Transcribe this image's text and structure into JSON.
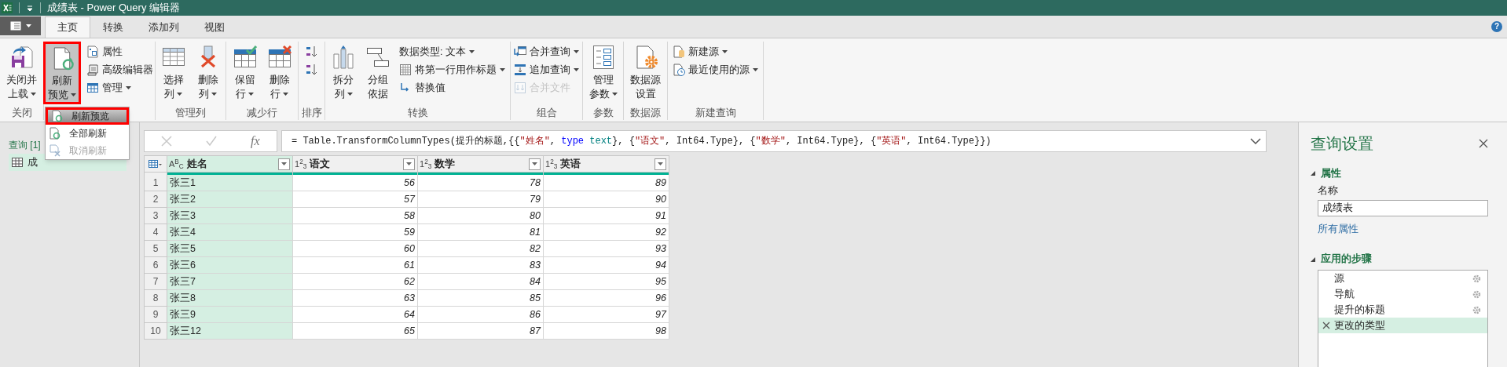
{
  "window": {
    "title": "成绩表 - Power Query 编辑器"
  },
  "help": "?",
  "tabs": [
    {
      "label": "主页",
      "selected": true
    },
    {
      "label": "转换",
      "selected": false
    },
    {
      "label": "添加列",
      "selected": false
    },
    {
      "label": "视图",
      "selected": false
    }
  ],
  "ribbon": [
    {
      "label": "关闭",
      "items": [
        {
          "kind": "large",
          "lines": [
            "关闭并",
            "上载"
          ],
          "dropdown": true,
          "pressed": false,
          "highlighted": false,
          "disabled": false
        }
      ]
    },
    {
      "items": [
        {
          "kind": "large",
          "lines": [
            "刷新",
            "预览"
          ],
          "dropdown": true,
          "pressed": true,
          "highlighted": true,
          "disabled": false
        },
        {
          "kind": "small",
          "label": "属性",
          "dropdown": false,
          "pressed": false,
          "highlighted": false,
          "disabled": false
        },
        {
          "kind": "small",
          "label": "高级编辑器",
          "dropdown": false,
          "pressed": false,
          "highlighted": false,
          "disabled": false
        },
        {
          "kind": "small",
          "label": "管理",
          "dropdown": true,
          "pressed": false,
          "highlighted": false,
          "disabled": false
        }
      ]
    },
    {
      "label": "管理列",
      "items": [
        {
          "kind": "large",
          "lines": [
            "选择",
            "列"
          ],
          "dropdown": true,
          "pressed": false,
          "highlighted": false,
          "disabled": false
        },
        {
          "kind": "large",
          "lines": [
            "删除",
            "列"
          ],
          "dropdown": true,
          "pressed": false,
          "highlighted": false,
          "disabled": false
        }
      ]
    },
    {
      "label": "减少行",
      "items": [
        {
          "kind": "large",
          "lines": [
            "保留",
            "行"
          ],
          "dropdown": true,
          "pressed": false,
          "highlighted": false,
          "disabled": false
        },
        {
          "kind": "large",
          "lines": [
            "删除",
            "行"
          ],
          "dropdown": true,
          "pressed": false,
          "highlighted": false,
          "disabled": false
        }
      ]
    },
    {
      "label": "排序",
      "items": [
        {
          "kind": "icon",
          "dropdown": false,
          "pressed": false,
          "highlighted": false,
          "disabled": false
        },
        {
          "kind": "icon",
          "dropdown": false,
          "pressed": false,
          "highlighted": false,
          "disabled": false
        }
      ]
    },
    {
      "label": "转换",
      "items": [
        {
          "kind": "large",
          "lines": [
            "拆分",
            "列"
          ],
          "dropdown": true,
          "pressed": false,
          "highlighted": false,
          "disabled": false
        },
        {
          "kind": "large",
          "lines": [
            "分组",
            "依据"
          ],
          "dropdown": false,
          "pressed": false,
          "highlighted": false,
          "disabled": false
        },
        {
          "kind": "small",
          "label": "数据类型: 文本",
          "dropdown": true,
          "pressed": false,
          "highlighted": false,
          "disabled": false
        },
        {
          "kind": "small",
          "label": "将第一行用作标题",
          "dropdown": true,
          "pressed": false,
          "highlighted": false,
          "disabled": false
        },
        {
          "kind": "small",
          "label": "替换值",
          "dropdown": false,
          "pressed": false,
          "highlighted": false,
          "disabled": false
        }
      ]
    },
    {
      "label": "组合",
      "items": [
        {
          "kind": "small",
          "label": "合并查询",
          "dropdown": true,
          "pressed": false,
          "highlighted": false,
          "disabled": false
        },
        {
          "kind": "small",
          "label": "追加查询",
          "dropdown": true,
          "pressed": false,
          "highlighted": false,
          "disabled": false
        },
        {
          "kind": "small",
          "label": "合并文件",
          "dropdown": false,
          "pressed": false,
          "highlighted": false,
          "disabled": true
        }
      ]
    },
    {
      "label": "参数",
      "items": [
        {
          "kind": "large",
          "lines": [
            "管理",
            "参数"
          ],
          "dropdown": true,
          "pressed": false,
          "highlighted": false,
          "disabled": false
        }
      ]
    },
    {
      "label": "数据源",
      "items": [
        {
          "kind": "large",
          "lines": [
            "数据源",
            "设置"
          ],
          "dropdown": false,
          "pressed": false,
          "highlighted": false,
          "disabled": false
        }
      ]
    },
    {
      "label": "新建查询",
      "items": [
        {
          "kind": "small",
          "label": "新建源",
          "dropdown": true,
          "pressed": false,
          "highlighted": false,
          "disabled": false
        },
        {
          "kind": "small",
          "label": "最近使用的源",
          "dropdown": true,
          "pressed": false,
          "highlighted": false,
          "disabled": false
        }
      ]
    }
  ],
  "refresh_menu": {
    "items": [
      {
        "label": "刷新预览",
        "selected": true,
        "highlighted": true,
        "disabled": false
      },
      {
        "label": "全部刷新",
        "selected": false,
        "highlighted": false,
        "disabled": false
      },
      {
        "label": "取消刷新",
        "selected": false,
        "highlighted": false,
        "disabled": true
      }
    ]
  },
  "queries": {
    "title": "查询 [1]",
    "items": [
      {
        "label": "成",
        "selected": true
      }
    ]
  },
  "formula_bar": {
    "fx": "fx",
    "tokens": [
      {
        "text": "= Table.TransformColumnTypes(提升的标题,{{",
        "kind": "plain"
      },
      {
        "text": "\"姓名\"",
        "kind": "string"
      },
      {
        "text": ", ",
        "kind": "plain"
      },
      {
        "text": "type",
        "kind": "keyword"
      },
      {
        "text": " text",
        "kind": "type"
      },
      {
        "text": "}, {",
        "kind": "plain"
      },
      {
        "text": "\"语文\"",
        "kind": "string"
      },
      {
        "text": ", Int64.Type}, {",
        "kind": "plain"
      },
      {
        "text": "\"数学\"",
        "kind": "string"
      },
      {
        "text": ", Int64.Type}, {",
        "kind": "plain"
      },
      {
        "text": "\"英语\"",
        "kind": "string"
      },
      {
        "text": ", Int64.Type}})",
        "kind": "plain"
      }
    ]
  },
  "table": {
    "columns": [
      {
        "type": "A$^{B}$$_{C}$",
        "name": "姓名",
        "selected": true
      },
      {
        "type": "1$^{2}$$_{3}$",
        "name": "语文",
        "selected": false
      },
      {
        "type": "1$^{2}$$_{3}$",
        "name": "数学",
        "selected": false
      },
      {
        "type": "1$^{2}$$_{3}$",
        "name": "英语",
        "selected": false
      }
    ],
    "rows": [
      {
        "index": "1",
        "cells": [
          "张三1",
          "56",
          "78",
          "89"
        ]
      },
      {
        "index": "2",
        "cells": [
          "张三2",
          "57",
          "79",
          "90"
        ]
      },
      {
        "index": "3",
        "cells": [
          "张三3",
          "58",
          "80",
          "91"
        ]
      },
      {
        "index": "4",
        "cells": [
          "张三4",
          "59",
          "81",
          "92"
        ]
      },
      {
        "index": "5",
        "cells": [
          "张三5",
          "60",
          "82",
          "93"
        ]
      },
      {
        "index": "6",
        "cells": [
          "张三6",
          "61",
          "83",
          "94"
        ]
      },
      {
        "index": "7",
        "cells": [
          "张三7",
          "62",
          "84",
          "95"
        ]
      },
      {
        "index": "8",
        "cells": [
          "张三8",
          "63",
          "85",
          "96"
        ]
      },
      {
        "index": "9",
        "cells": [
          "张三9",
          "64",
          "86",
          "97"
        ]
      },
      {
        "index": "10",
        "cells": [
          "张三12",
          "65",
          "87",
          "98"
        ]
      }
    ]
  },
  "query_settings": {
    "title": "查询设置",
    "properties": {
      "heading": "属性",
      "name_label": "名称",
      "name_value": "成绩表",
      "all_properties_link": "所有属性"
    },
    "steps": {
      "heading": "应用的步骤",
      "items": [
        {
          "label": "源",
          "selected": false,
          "has_settings": true
        },
        {
          "label": "导航",
          "selected": false,
          "has_settings": true
        },
        {
          "label": "提升的标题",
          "selected": false,
          "has_settings": true
        },
        {
          "label": "更改的类型",
          "selected": true,
          "has_settings": false
        }
      ]
    }
  }
}
